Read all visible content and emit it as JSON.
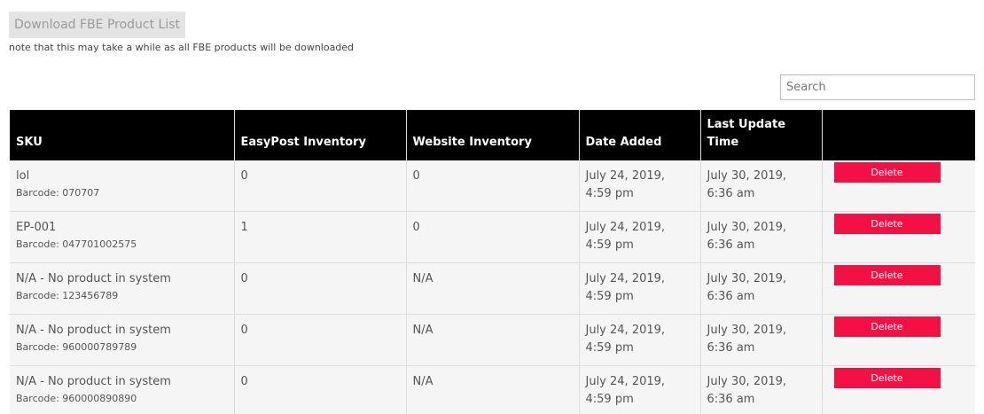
{
  "toolbar": {
    "download_label": "Download FBE Product List",
    "note": "note that this may take a while as all FBE products will be downloaded"
  },
  "search": {
    "placeholder": "Search",
    "value": ""
  },
  "table": {
    "headers": {
      "sku": "SKU",
      "easypost": "EasyPost Inventory",
      "website": "Website Inventory",
      "date_added": "Date Added",
      "last_update": "Last Update Time",
      "actions": ""
    },
    "rows": [
      {
        "sku": "lol",
        "barcode": "Barcode: 070707",
        "easypost": "0",
        "website": "0",
        "date_added": "July 24, 2019, 4:59 pm",
        "last_update": "July 30, 2019, 6:36 am",
        "delete_label": "Delete"
      },
      {
        "sku": "EP-001",
        "barcode": "Barcode: 047701002575",
        "easypost": "1",
        "website": "0",
        "date_added": "July 24, 2019, 4:59 pm",
        "last_update": "July 30, 2019, 6:36 am",
        "delete_label": "Delete"
      },
      {
        "sku": "N/A - No product in system",
        "barcode": "Barcode: 123456789",
        "easypost": "0",
        "website": "N/A",
        "date_added": "July 24, 2019, 4:59 pm",
        "last_update": "July 30, 2019, 6:36 am",
        "delete_label": "Delete"
      },
      {
        "sku": "N/A - No product in system",
        "barcode": "Barcode: 960000789789",
        "easypost": "0",
        "website": "N/A",
        "date_added": "July 24, 2019, 4:59 pm",
        "last_update": "July 30, 2019, 6:36 am",
        "delete_label": "Delete"
      },
      {
        "sku": "N/A - No product in system",
        "barcode": "Barcode: 960000890890",
        "easypost": "0",
        "website": "N/A",
        "date_added": "July 24, 2019, 4:59 pm",
        "last_update": "July 30, 2019, 6:36 am",
        "delete_label": "Delete"
      }
    ]
  },
  "colors": {
    "header_bg": "#000000",
    "row_bg": "#f5f5f5",
    "delete_bg": "#f51044",
    "download_bg": "#e4e4e4"
  }
}
